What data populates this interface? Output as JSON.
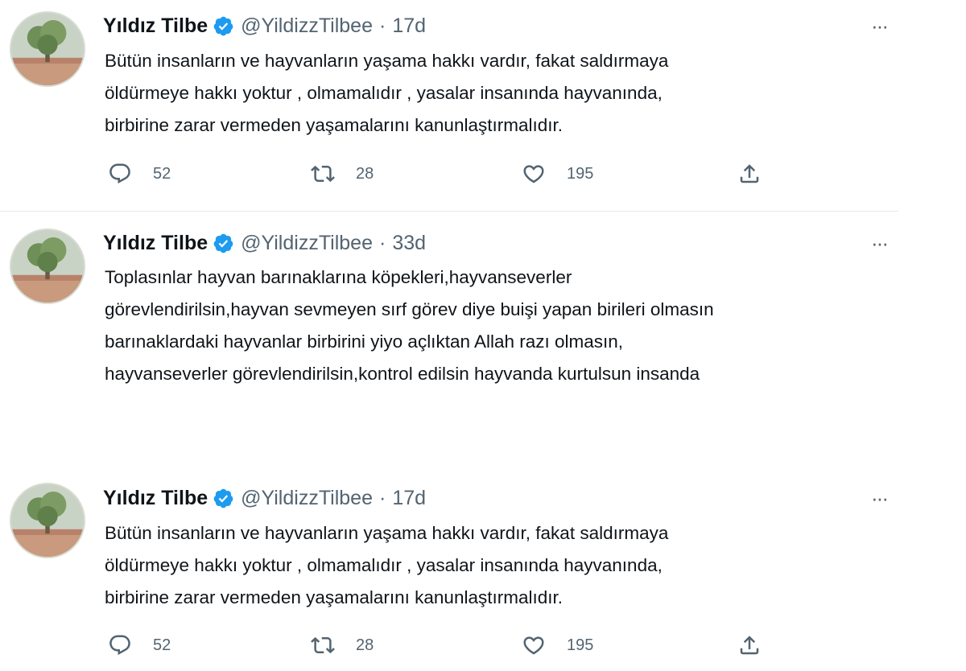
{
  "tweets": [
    {
      "name": "Yıldız Tilbe",
      "handle": "@YildizzTilbee",
      "dot": "·",
      "time": "17d",
      "more": "···",
      "lines": [
        "Bütün insanların ve hayvanların  yaşama hakkı vardır, fakat saldırmaya",
        "öldürmeye hakkı yoktur , olmamalıdır , yasalar insanında  hayvanında,",
        "birbirine zarar vermeden yaşamalarını  kanunlaştırmalıdır."
      ],
      "replies": "52",
      "retweets": "28",
      "likes": "195"
    },
    {
      "name": "Yıldız Tilbe",
      "handle": "@YildizzTilbee",
      "dot": "·",
      "time": "33d",
      "more": "···",
      "lines": [
        "Toplasınlar hayvan barınaklarına köpekleri,hayvanseverler",
        "görevlendirilsin,hayvan sevmeyen sırf görev diye buişi yapan birileri olmasın",
        "barınaklardaki hayvanlar birbirini yiyo açlıktan Allah razı olmasın,",
        "hayvanseverler görevlendirilsin,kontrol edilsin hayvanda kurtulsun insanda"
      ]
    },
    {
      "name": "Yıldız Tilbe",
      "handle": "@YildizzTilbee",
      "dot": "·",
      "time": "17d",
      "more": "···",
      "lines": [
        "Bütün insanların ve hayvanların  yaşama hakkı vardır, fakat saldırmaya",
        "öldürmeye hakkı yoktur , olmamalıdır , yasalar insanında  hayvanında,",
        "birbirine zarar vermeden yaşamalarını  kanunlaştırmalıdır."
      ],
      "replies": "52",
      "retweets": "28",
      "likes": "195"
    }
  ],
  "icons": {
    "verified": "verified-badge-icon",
    "reply": "reply-icon",
    "retweet": "retweet-icon",
    "like": "heart-icon",
    "share": "share-icon",
    "more": "more-options-icon"
  },
  "colors": {
    "verified": "#1d9bf0",
    "text": "#0f1419",
    "muted": "#536471"
  }
}
